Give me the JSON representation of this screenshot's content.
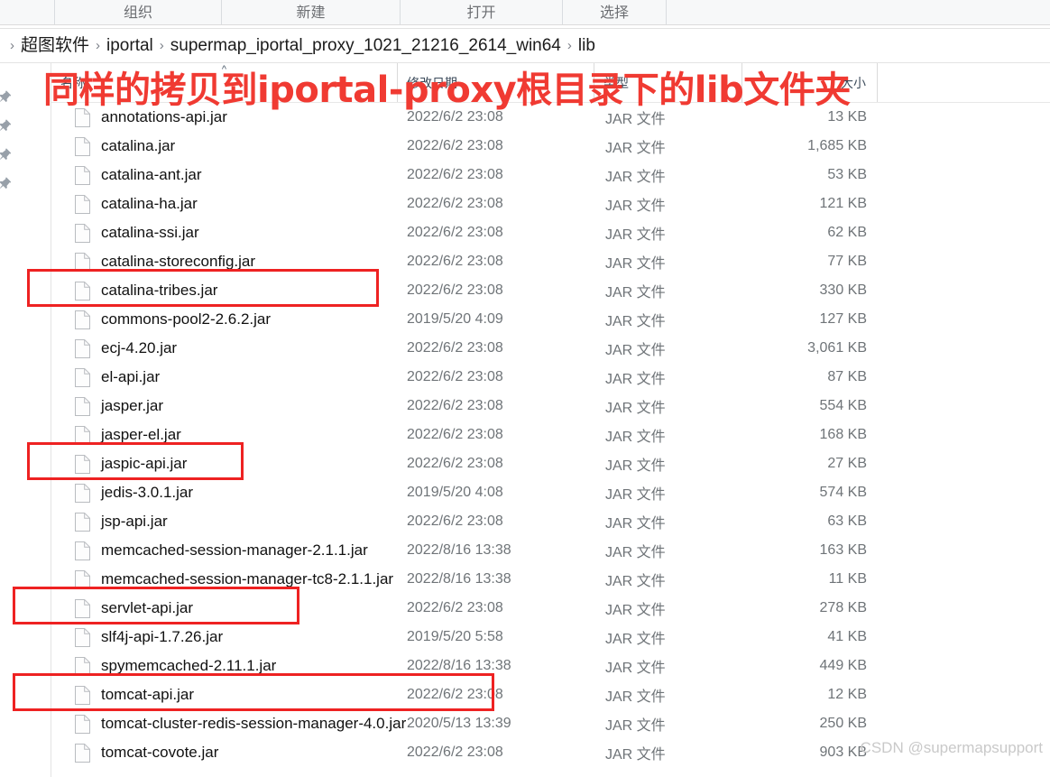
{
  "window": {
    "ribbon_groups": [
      {
        "label": "组织"
      },
      {
        "label": "新建"
      },
      {
        "label": "打开"
      },
      {
        "label": "选择"
      }
    ]
  },
  "breadcrumb": {
    "separator": "›",
    "items": [
      {
        "label": "超图软件"
      },
      {
        "label": "iportal"
      },
      {
        "label": "supermap_iportal_proxy_1021_21216_2614_win64"
      },
      {
        "label": "lib"
      }
    ]
  },
  "columns": [
    {
      "key": "name",
      "label": "名称",
      "sort_indicator": "^"
    },
    {
      "key": "date",
      "label": "修改日期",
      "sort_indicator": ""
    },
    {
      "key": "type",
      "label": "类型",
      "sort_indicator": ""
    },
    {
      "key": "size",
      "label": "大小",
      "sort_indicator": ""
    }
  ],
  "files": [
    {
      "name": "annotations-api.jar",
      "date": "2022/6/2 23:08",
      "type": "JAR 文件",
      "size": "13 KB",
      "highlighted": false
    },
    {
      "name": "catalina.jar",
      "date": "2022/6/2 23:08",
      "type": "JAR 文件",
      "size": "1,685 KB",
      "highlighted": false
    },
    {
      "name": "catalina-ant.jar",
      "date": "2022/6/2 23:08",
      "type": "JAR 文件",
      "size": "53 KB",
      "highlighted": false
    },
    {
      "name": "catalina-ha.jar",
      "date": "2022/6/2 23:08",
      "type": "JAR 文件",
      "size": "121 KB",
      "highlighted": false
    },
    {
      "name": "catalina-ssi.jar",
      "date": "2022/6/2 23:08",
      "type": "JAR 文件",
      "size": "62 KB",
      "highlighted": false
    },
    {
      "name": "catalina-storeconfig.jar",
      "date": "2022/6/2 23:08",
      "type": "JAR 文件",
      "size": "77 KB",
      "highlighted": false
    },
    {
      "name": "catalina-tribes.jar",
      "date": "2022/6/2 23:08",
      "type": "JAR 文件",
      "size": "330 KB",
      "highlighted": false
    },
    {
      "name": "commons-pool2-2.6.2.jar",
      "date": "2019/5/20 4:09",
      "type": "JAR 文件",
      "size": "127 KB",
      "highlighted": true
    },
    {
      "name": "ecj-4.20.jar",
      "date": "2022/6/2 23:08",
      "type": "JAR 文件",
      "size": "3,061 KB",
      "highlighted": false
    },
    {
      "name": "el-api.jar",
      "date": "2022/6/2 23:08",
      "type": "JAR 文件",
      "size": "87 KB",
      "highlighted": false
    },
    {
      "name": "jasper.jar",
      "date": "2022/6/2 23:08",
      "type": "JAR 文件",
      "size": "554 KB",
      "highlighted": false
    },
    {
      "name": "jasper-el.jar",
      "date": "2022/6/2 23:08",
      "type": "JAR 文件",
      "size": "168 KB",
      "highlighted": false
    },
    {
      "name": "jaspic-api.jar",
      "date": "2022/6/2 23:08",
      "type": "JAR 文件",
      "size": "27 KB",
      "highlighted": false
    },
    {
      "name": "jedis-3.0.1.jar",
      "date": "2019/5/20 4:08",
      "type": "JAR 文件",
      "size": "574 KB",
      "highlighted": true
    },
    {
      "name": "jsp-api.jar",
      "date": "2022/6/2 23:08",
      "type": "JAR 文件",
      "size": "63 KB",
      "highlighted": false
    },
    {
      "name": "memcached-session-manager-2.1.1.jar",
      "date": "2022/8/16 13:38",
      "type": "JAR 文件",
      "size": "163 KB",
      "highlighted": false
    },
    {
      "name": "memcached-session-manager-tc8-2.1.1.jar",
      "date": "2022/8/16 13:38",
      "type": "JAR 文件",
      "size": "11 KB",
      "highlighted": false
    },
    {
      "name": "servlet-api.jar",
      "date": "2022/6/2 23:08",
      "type": "JAR 文件",
      "size": "278 KB",
      "highlighted": false
    },
    {
      "name": "slf4j-api-1.7.26.jar",
      "date": "2019/5/20 5:58",
      "type": "JAR 文件",
      "size": "41 KB",
      "highlighted": true
    },
    {
      "name": "spymemcached-2.11.1.jar",
      "date": "2022/8/16 13:38",
      "type": "JAR 文件",
      "size": "449 KB",
      "highlighted": false
    },
    {
      "name": "tomcat-api.jar",
      "date": "2022/6/2 23:08",
      "type": "JAR 文件",
      "size": "12 KB",
      "highlighted": false
    },
    {
      "name": "tomcat-cluster-redis-session-manager-4.0.jar",
      "date": "2020/5/13 13:39",
      "type": "JAR 文件",
      "size": "250 KB",
      "highlighted": true
    },
    {
      "name": "tomcat-covote.jar",
      "date": "2022/6/2 23:08",
      "type": "JAR 文件",
      "size": "903 KB",
      "highlighted": false
    }
  ],
  "annotation": {
    "text": "同样的拷贝到iportal-proxy根目录下的lib文件夹",
    "color": "#f03a32",
    "highlight_color": "#ee2222"
  },
  "watermark": {
    "text": "CSDN @supermapsupport"
  },
  "navpane": {
    "pins": [
      {
        "name": "quick-access-pin"
      },
      {
        "name": "quick-access-pin"
      },
      {
        "name": "quick-access-pin"
      },
      {
        "name": "quick-access-pin"
      }
    ]
  }
}
